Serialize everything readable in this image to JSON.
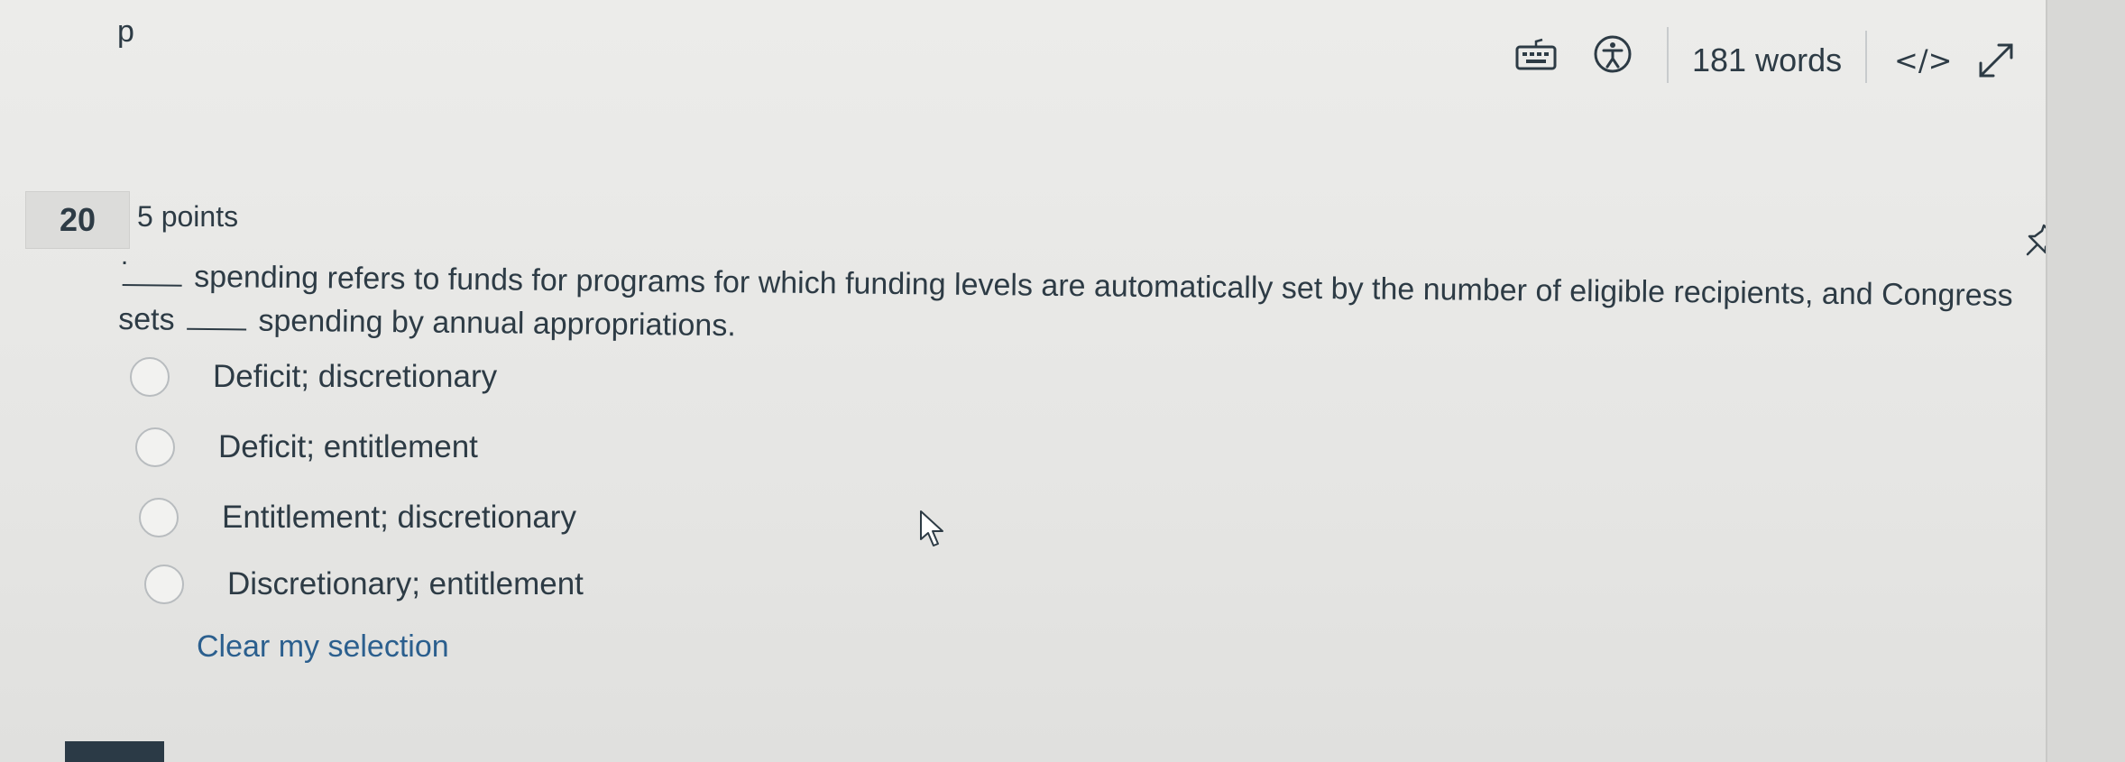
{
  "editor": {
    "footer_tag": "p",
    "word_count": "181 words",
    "html_toggle": "</>",
    "icons": [
      "keyboard-icon",
      "accessibility-icon",
      "html-editor-icon",
      "fullscreen-icon",
      "drag-handle-icon"
    ]
  },
  "question": {
    "number": "20",
    "points": "5 points",
    "dot": ".",
    "text_part1": "spending refers to funds for programs for which funding levels are automatically set by the number of eligible recipients, and Congress sets",
    "text_part2": "spending by annual appropriations.",
    "answers": [
      "Deficit; discretionary",
      "Deficit; entitlement",
      "Entitlement; discretionary",
      "Discretionary; entitlement"
    ],
    "clear_label": "Clear my selection"
  },
  "colors": {
    "text": "#2d3b45",
    "link": "#2b5f8e",
    "background": "#e8e8e6"
  }
}
